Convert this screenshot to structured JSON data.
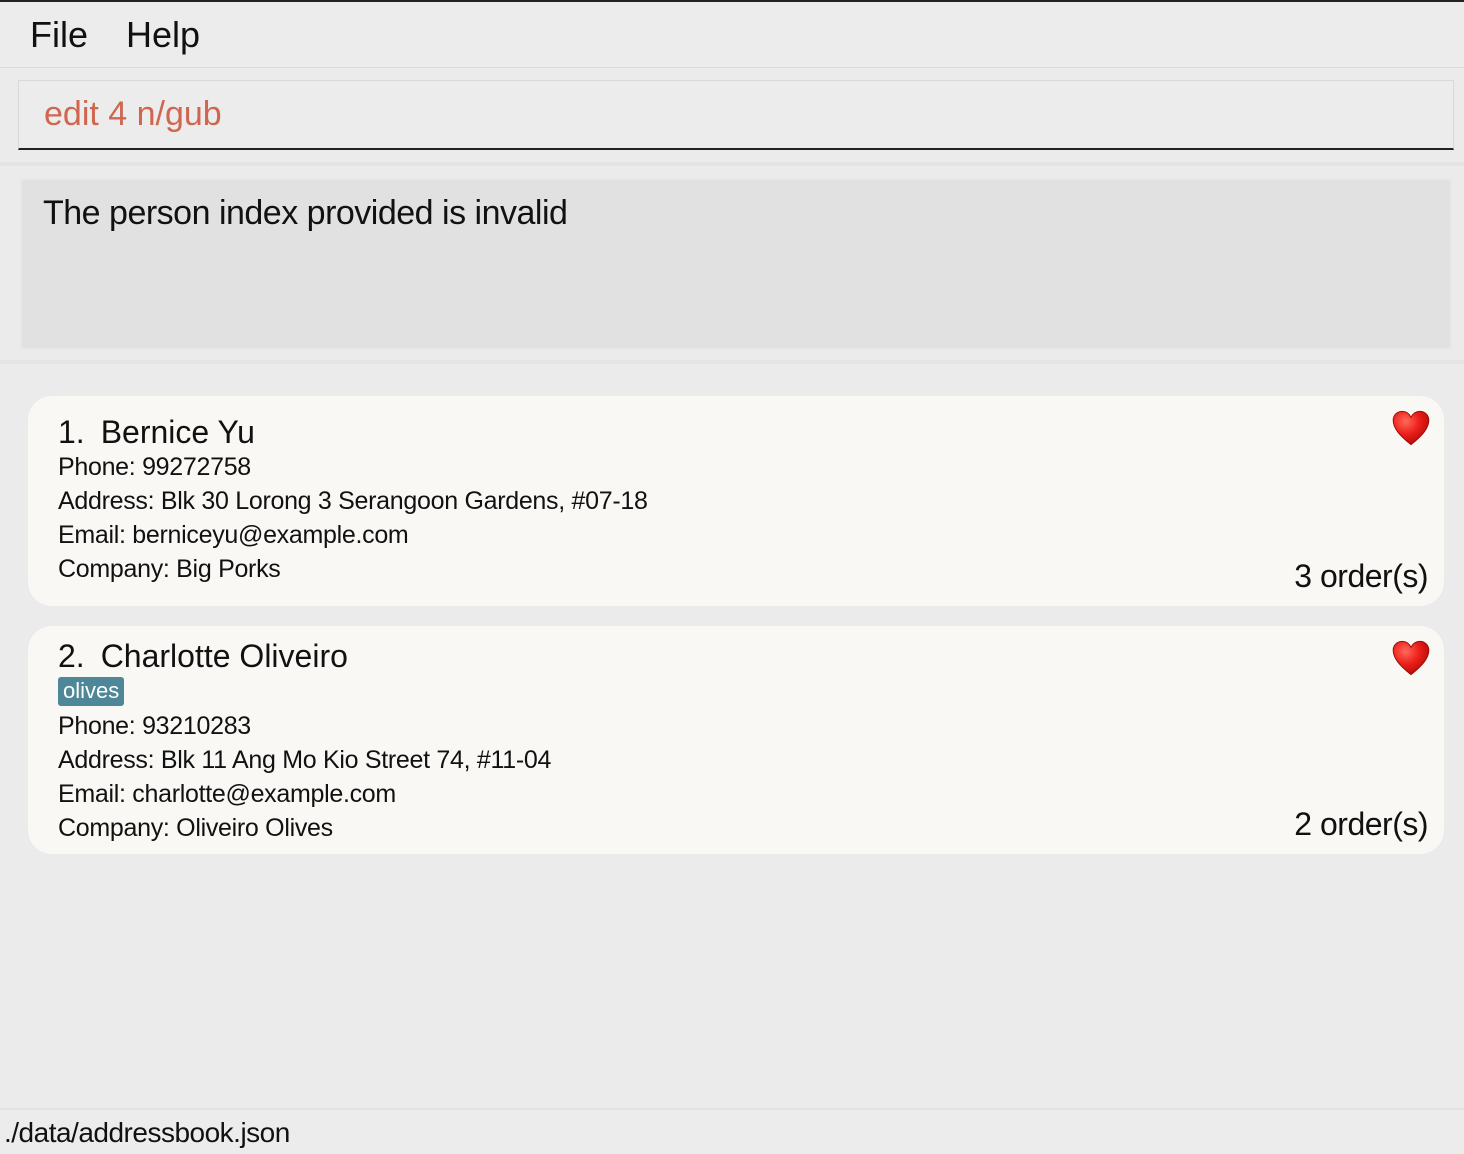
{
  "menu": {
    "file_label": "File",
    "help_label": "Help"
  },
  "command": {
    "value": "edit 4 n/gub"
  },
  "result": {
    "message": "The person index provided is invalid"
  },
  "persons": [
    {
      "index": "1.",
      "name": "Bernice Yu",
      "tags": [],
      "phone": "Phone: 99272758",
      "address": "Address: Blk 30 Lorong 3 Serangoon Gardens, #07-18",
      "email": "Email: berniceyu@example.com",
      "company": "Company: Big Porks",
      "orders": "3 order(s)",
      "favourite_icon": "heart-icon"
    },
    {
      "index": "2.",
      "name": "Charlotte Oliveiro",
      "tags": [
        "olives"
      ],
      "phone": "Phone: 93210283",
      "address": "Address: Blk 11 Ang Mo Kio Street 74, #11-04",
      "email": "Email: charlotte@example.com",
      "company": "Company: Oliveiro Olives",
      "orders": "2 order(s)",
      "favourite_icon": "heart-icon"
    }
  ],
  "status": {
    "file_path": "./data/addressbook.json"
  },
  "colors": {
    "command_text": "#d06650",
    "tag_background": "#4e8898",
    "heart": "#e8201c",
    "card_background": "#f9f8f5"
  }
}
